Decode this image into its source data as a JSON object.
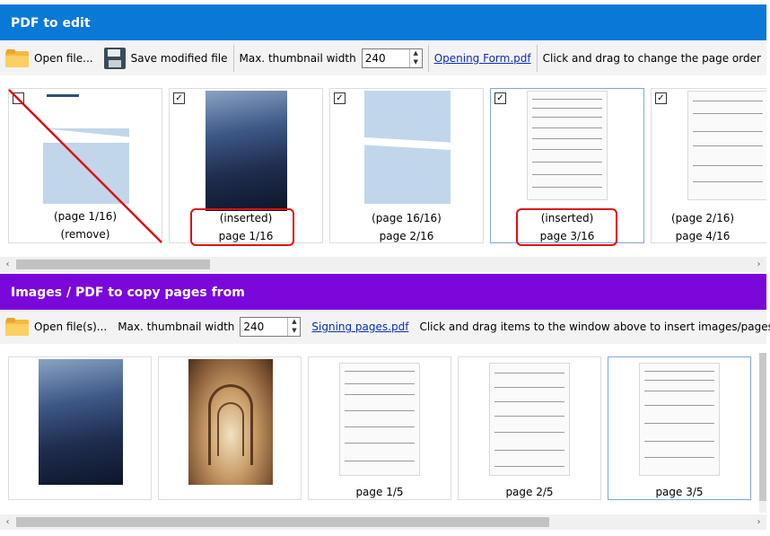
{
  "top": {
    "header": "PDF to edit",
    "open_label": "Open file...",
    "save_label": "Save modified file",
    "width_label": "Max. thumbnail width",
    "width_value": "240",
    "file_link": "Opening Form.pdf",
    "hint": "Click and drag to change the page order",
    "pages": [
      {
        "line1": "(page 1/16)",
        "line2": "(remove)",
        "checked": false,
        "thumb": "text-cover-icon"
      },
      {
        "line1": "(inserted)",
        "line2": "page 1/16",
        "checked": true,
        "thumb": "photo-sky-icon"
      },
      {
        "line1": "(page 16/16)",
        "line2": "page 2/16",
        "checked": true,
        "thumb": "blue-cover-icon"
      },
      {
        "line1": "(inserted)",
        "line2": "page 3/16",
        "checked": true,
        "thumb": "form-page-icon"
      },
      {
        "line1": "(page 2/16)",
        "line2": "page 4/16",
        "checked": true,
        "thumb": "form-page-icon"
      }
    ]
  },
  "bottom": {
    "header": "Images / PDF to copy pages from",
    "open_label": "Open file(s)...",
    "width_label": "Max. thumbnail width",
    "width_value": "240",
    "file_link": "Signing pages.pdf",
    "hint": "Click and drag items to the window above to insert images/pages",
    "items": [
      {
        "label": "",
        "thumb": "photo-sky-icon"
      },
      {
        "label": "",
        "thumb": "photo-arch-icon"
      },
      {
        "label": "page 1/5",
        "thumb": "form-page-icon"
      },
      {
        "label": "page 2/5",
        "thumb": "form-page-icon"
      },
      {
        "label": "page 3/5",
        "thumb": "form-page-icon"
      }
    ]
  },
  "icons": {
    "check_mark": "✓",
    "scroll_left": "‹",
    "scroll_right": "›",
    "spin_up": "▲",
    "spin_down": "▼"
  },
  "colors": {
    "top_header": "#0a78d7",
    "bottom_header": "#7b08db",
    "annotation": "#e01010"
  }
}
